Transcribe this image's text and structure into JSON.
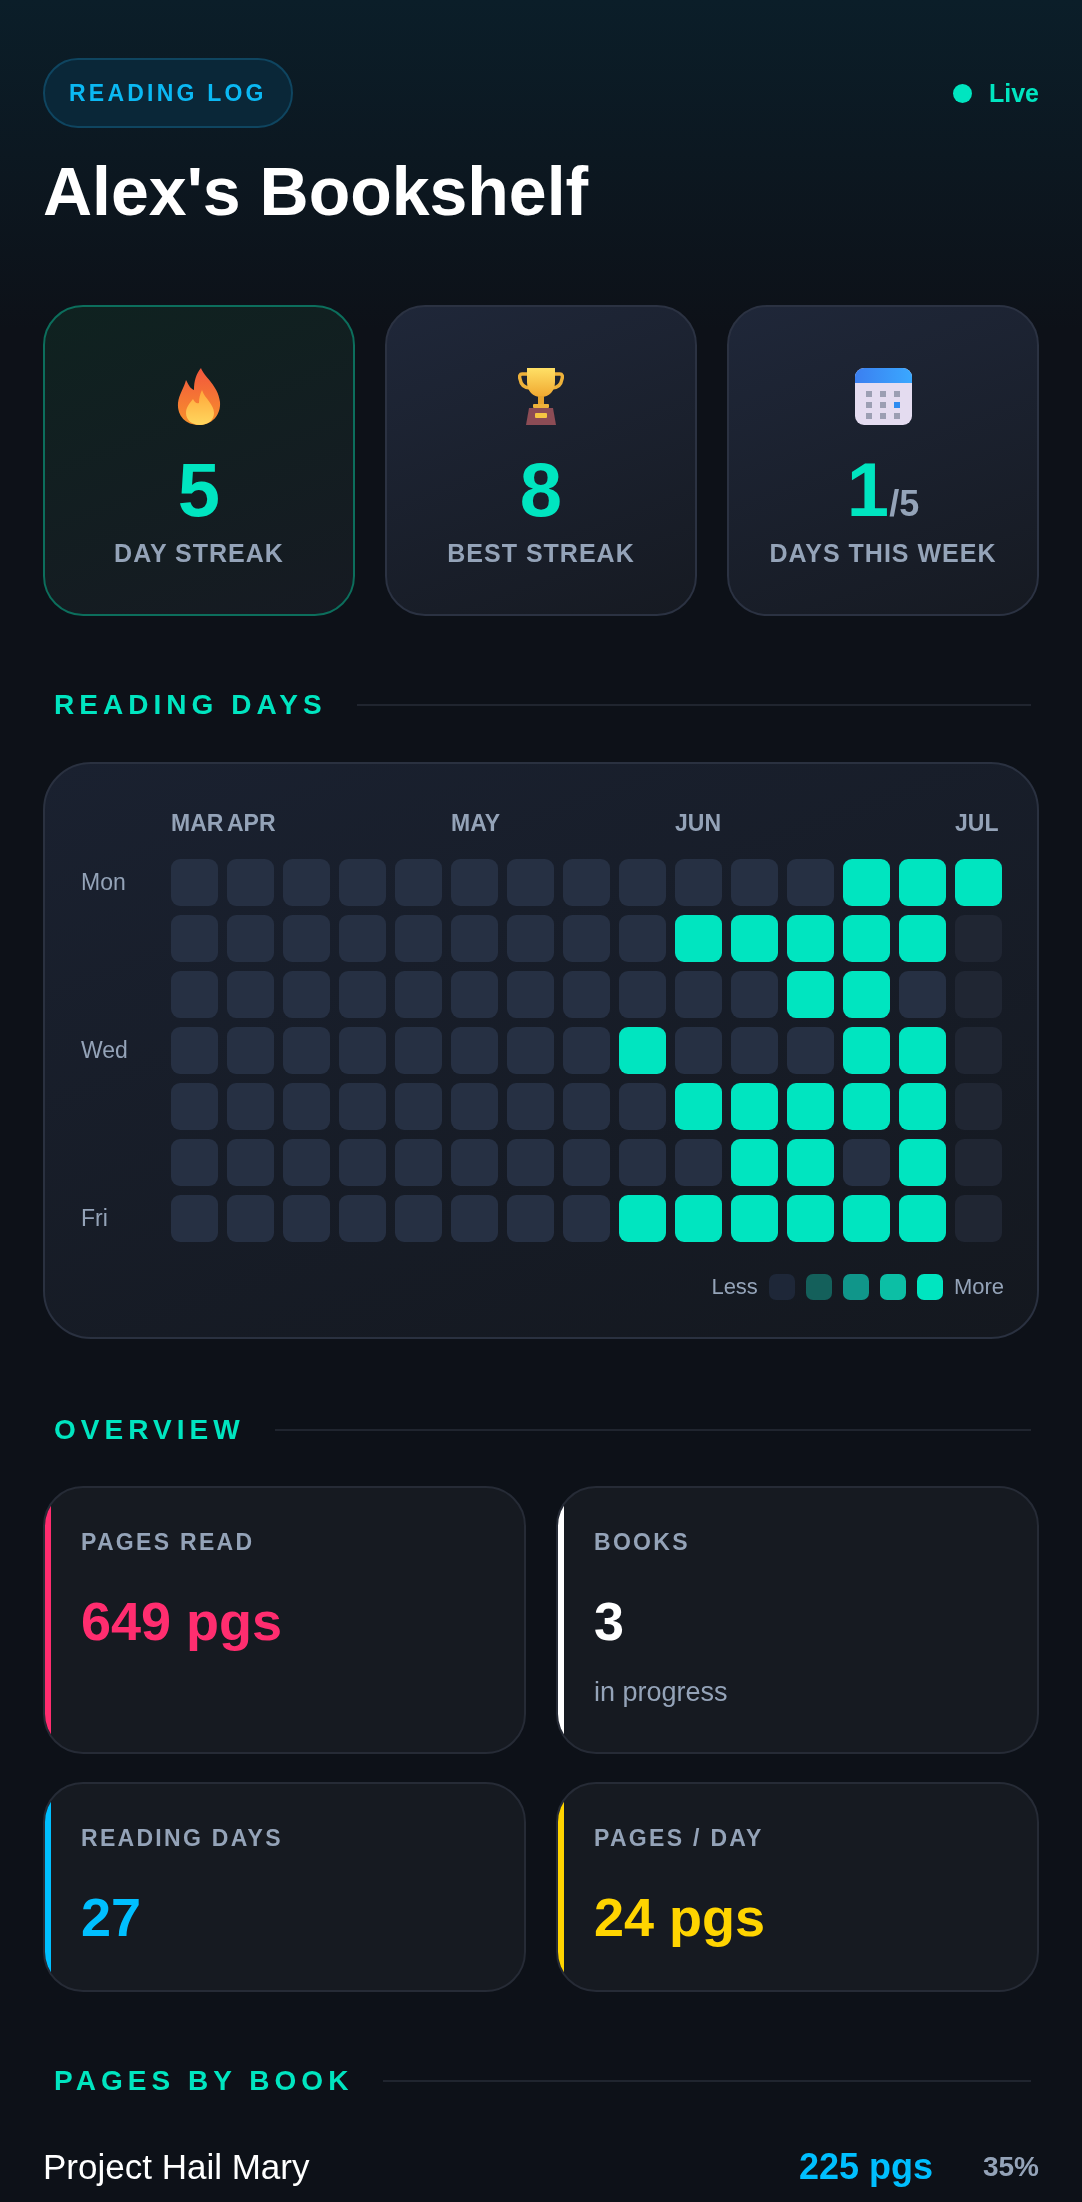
{
  "header": {
    "badge": "READING LOG",
    "status": {
      "label": "Live"
    },
    "title": "Alex's Bookshelf"
  },
  "stats": [
    {
      "kind": "current_streak",
      "value": "5",
      "label": "DAY STREAK",
      "highlighted": true
    },
    {
      "kind": "best_streak",
      "value": "8",
      "label": "BEST STREAK",
      "highlighted": false
    },
    {
      "kind": "week",
      "value": "1",
      "suffix": "/5",
      "label": "DAYS THIS WEEK",
      "highlighted": false
    }
  ],
  "reading_days": {
    "heading": "READING DAYS",
    "heatmap": {
      "weekday_labels": [
        "Mon",
        "Wed",
        "Fri"
      ],
      "months": [
        {
          "label": "MAR",
          "weeks": [
            {
              "days": [
                {
                  "kind": "empty"
                },
                {
                  "kind": "empty"
                },
                {
                  "kind": "empty"
                },
                {
                  "kind": "empty"
                },
                {
                  "kind": "empty"
                },
                {
                  "kind": "empty"
                },
                {
                  "kind": "empty"
                }
              ]
            }
          ]
        },
        {
          "label": "APR",
          "weeks": [
            {
              "days": [
                {
                  "kind": "empty"
                },
                {
                  "kind": "empty"
                },
                {
                  "kind": "empty"
                },
                {
                  "kind": "empty"
                },
                {
                  "kind": "empty"
                },
                {
                  "kind": "empty"
                },
                {
                  "kind": "empty"
                }
              ]
            },
            {
              "days": [
                {
                  "kind": "empty"
                },
                {
                  "kind": "empty"
                },
                {
                  "kind": "empty"
                },
                {
                  "kind": "empty"
                },
                {
                  "kind": "empty"
                },
                {
                  "kind": "empty"
                },
                {
                  "kind": "empty"
                }
              ]
            },
            {
              "days": [
                {
                  "kind": "empty"
                },
                {
                  "kind": "empty"
                },
                {
                  "kind": "empty"
                },
                {
                  "kind": "empty"
                },
                {
                  "kind": "empty"
                },
                {
                  "kind": "empty"
                },
                {
                  "kind": "empty"
                }
              ]
            },
            {
              "days": [
                {
                  "kind": "empty"
                },
                {
                  "kind": "empty"
                },
                {
                  "kind": "empty"
                },
                {
                  "kind": "empty"
                },
                {
                  "kind": "empty"
                },
                {
                  "kind": "empty"
                },
                {
                  "kind": "empty"
                }
              ]
            }
          ]
        },
        {
          "label": "MAY",
          "weeks": [
            {
              "days": [
                {
                  "kind": "empty"
                },
                {
                  "kind": "empty"
                },
                {
                  "kind": "empty"
                },
                {
                  "kind": "empty"
                },
                {
                  "kind": "empty"
                },
                {
                  "kind": "empty"
                },
                {
                  "kind": "empty"
                }
              ]
            },
            {
              "days": [
                {
                  "kind": "empty"
                },
                {
                  "kind": "empty"
                },
                {
                  "kind": "empty"
                },
                {
                  "kind": "empty"
                },
                {
                  "kind": "empty"
                },
                {
                  "kind": "empty"
                },
                {
                  "kind": "empty"
                }
              ]
            },
            {
              "days": [
                {
                  "kind": "empty"
                },
                {
                  "kind": "empty"
                },
                {
                  "kind": "empty"
                },
                {
                  "kind": "empty"
                },
                {
                  "kind": "empty"
                },
                {
                  "kind": "empty"
                },
                {
                  "kind": "empty"
                }
              ]
            },
            {
              "days": [
                {
                  "kind": "empty"
                },
                {
                  "kind": "empty"
                },
                {
                  "kind": "empty"
                },
                {
                  "kind": "read"
                },
                {
                  "kind": "empty"
                },
                {
                  "kind": "empty"
                },
                {
                  "kind": "read"
                }
              ]
            }
          ]
        },
        {
          "label": "JUN",
          "weeks": [
            {
              "days": [
                {
                  "kind": "empty"
                },
                {
                  "kind": "read"
                },
                {
                  "kind": "empty"
                },
                {
                  "kind": "empty"
                },
                {
                  "kind": "read"
                },
                {
                  "kind": "empty"
                },
                {
                  "kind": "read"
                }
              ]
            },
            {
              "days": [
                {
                  "kind": "empty"
                },
                {
                  "kind": "read"
                },
                {
                  "kind": "empty"
                },
                {
                  "kind": "empty"
                },
                {
                  "kind": "read"
                },
                {
                  "kind": "read"
                },
                {
                  "kind": "read"
                }
              ]
            },
            {
              "days": [
                {
                  "kind": "empty"
                },
                {
                  "kind": "read"
                },
                {
                  "kind": "read"
                },
                {
                  "kind": "empty"
                },
                {
                  "kind": "read"
                },
                {
                  "kind": "read"
                },
                {
                  "kind": "read"
                }
              ]
            },
            {
              "days": [
                {
                  "kind": "read"
                },
                {
                  "kind": "read"
                },
                {
                  "kind": "read"
                },
                {
                  "kind": "read"
                },
                {
                  "kind": "read"
                },
                {
                  "kind": "empty"
                },
                {
                  "kind": "read"
                }
              ]
            },
            {
              "days": [
                {
                  "kind": "read"
                },
                {
                  "kind": "read"
                },
                {
                  "kind": "empty"
                },
                {
                  "kind": "read"
                },
                {
                  "kind": "read"
                },
                {
                  "kind": "read"
                },
                {
                  "kind": "read"
                }
              ]
            }
          ]
        },
        {
          "label": "JUL",
          "weeks": [
            {
              "days": [
                {
                  "kind": "read"
                },
                {
                  "kind": "future"
                },
                {
                  "kind": "future"
                },
                {
                  "kind": "future"
                },
                {
                  "kind": "future"
                },
                {
                  "kind": "future"
                },
                {
                  "kind": "future"
                }
              ]
            }
          ]
        }
      ],
      "legend": {
        "less": "Less",
        "more": "More",
        "swatches": [
          {
            "color": "#1e2738"
          },
          {
            "color": "#14605b"
          },
          {
            "color": "#10968a"
          },
          {
            "color": "#0cbfa5"
          },
          {
            "color": "#00e5c0"
          }
        ]
      }
    }
  },
  "overview": {
    "heading": "OVERVIEW",
    "cards": [
      {
        "label": "PAGES READ",
        "value": "649 pgs",
        "color": "#ff2d6f"
      },
      {
        "label": "BOOKS",
        "value": "3",
        "note": "in progress",
        "color": "#ffffff"
      },
      {
        "label": "READING DAYS",
        "value": "27",
        "color": "#00bfff"
      },
      {
        "label": "PAGES / DAY",
        "value": "24 pgs",
        "color": "#ffd400"
      }
    ]
  },
  "pages_by_book": {
    "heading": "PAGES BY BOOK",
    "books": [
      {
        "title": "Project Hail Mary",
        "pages": "225 pgs",
        "percent": "35%",
        "color": "#00bfff"
      }
    ]
  }
}
